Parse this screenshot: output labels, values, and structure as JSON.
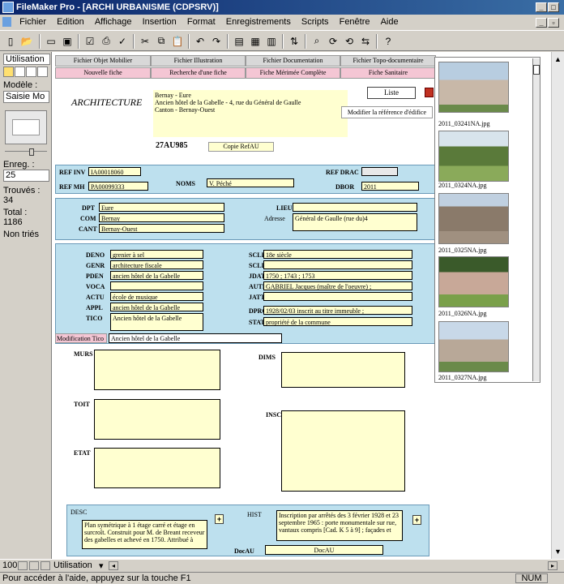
{
  "window": {
    "title": "FileMaker Pro - [ARCHI URBANISME (CDPSRV)]"
  },
  "menu": [
    "Fichier",
    "Edition",
    "Affichage",
    "Insertion",
    "Format",
    "Enregistrements",
    "Scripts",
    "Fenêtre",
    "Aide"
  ],
  "status_area": {
    "mode_label": "Utilisation",
    "model_label": "Modèle :",
    "model_value": "Saisie Mo",
    "record_label": "Enreg. :",
    "record_value": "25",
    "found_label": "Trouvés :",
    "found_value": "34",
    "total_label": "Total :",
    "total_value": "1186",
    "sort_status": "Non triés"
  },
  "nav": {
    "row1": [
      "Fichier Objet Mobilier",
      "Fichier Illustration",
      "Fichier Documentation",
      "Fichier Topo-documentaire"
    ],
    "row2": [
      "Nouvelle fiche",
      "Recherche d'une fiche",
      "Fiche Mérimée Complète",
      "Fiche Sanitaire"
    ]
  },
  "header": {
    "section": "ARCHITECTURE",
    "address": "Bernay - Eure\nAncien hôtel de la Gabelle - 4, rue du Général de Gaulle\nCanton - Bernay-Ouest",
    "list_button": "Liste",
    "modify_button": "Modifier la référence d'édifice",
    "ref_code": "27AU985",
    "copy_button": "Copie RefAU"
  },
  "refs": {
    "refinv_label": "REF INV",
    "refinv": "IA00018060",
    "refmh_label": "REF MH",
    "refmh": "PA00099333",
    "noms_label": "NOMS",
    "noms": "V. Péché",
    "refdrac_label": "REF DRAC",
    "refdrac": "",
    "dbor_label": "DBOR",
    "dbor": "2011"
  },
  "location": {
    "dpt_label": "DPT",
    "dpt": "Eure",
    "com_label": "COM",
    "com": "Bernay",
    "cant_label": "CANT",
    "cant": "Bernay-Ouest",
    "lieu_label": "LIEU",
    "lieu": "",
    "adresse_label": "Adresse",
    "adresse": "Général de Gaulle (rue du)4"
  },
  "designation": {
    "deno_label": "DENO",
    "deno": "grenier à sel",
    "genr_label": "GENR",
    "genr": "architecture fiscale",
    "pden_label": "PDEN",
    "pden": "ancien hôtel de la Gabelle",
    "voca_label": "VOCA",
    "voca": "",
    "actu_label": "ACTU",
    "actu": "école de musique",
    "appl_label": "APPL",
    "appl": "ancien hôtel de la Gabelle",
    "tico_label": "TICO",
    "tico": "Ancien hôtel de la Gabelle",
    "scle_label": "SCLE",
    "scle": "18e siècle",
    "scld_label": "SCLD",
    "scld": "",
    "jdat_label": "JDAT",
    "jdat": "1750 ; 1743 ; 1753",
    "autr_label": "AUTR",
    "autr": "GABRIEL Jacques (maître de l'oeuvre) ;",
    "jatt_label": "JATT",
    "jatt": "",
    "dpro_label": "DPRO",
    "dpro": "1928/02/03 inscrit au titre immeuble ;",
    "stat_label": "STAT",
    "stat": "propriété de la commune",
    "modtico_label": "Modification Tico",
    "modtico": "Ancien hôtel de la Gabelle"
  },
  "description": {
    "murs_label": "MURS",
    "toit_label": "TOIT",
    "etat_label": "ETAT",
    "dims_label": "DIMS",
    "insc_label": "INSC"
  },
  "bottom_section": {
    "desc_label": "DESC",
    "desc": "Plan symétrique à 1 étage carré et étage en surcroît. Construit pour M. de Breant receveur des gabelles et achevé en 1750. Attribué à",
    "hist_label": "HIST",
    "hist": "Inscription par arrêtés des 3 février 1928 et 23 septembre 1965 : porte monumentale sur rue, vantaux compris [Cad. K 5 à 9] ; façades et",
    "docau_label": "DocAU",
    "docau": "DocAU",
    "plus": "+"
  },
  "thumbnails": [
    "2011_03241NA.jpg",
    "2011_0324NA.jpg",
    "2011_0325NA.jpg",
    "2011_0326NA.jpg",
    "2011_0327NA.jpg"
  ],
  "bottombar": {
    "zoom": "100",
    "mode": "Utilisation"
  },
  "statusbar": {
    "help": "Pour accéder à l'aide, appuyez sur la touche F1",
    "num": "NUM"
  }
}
